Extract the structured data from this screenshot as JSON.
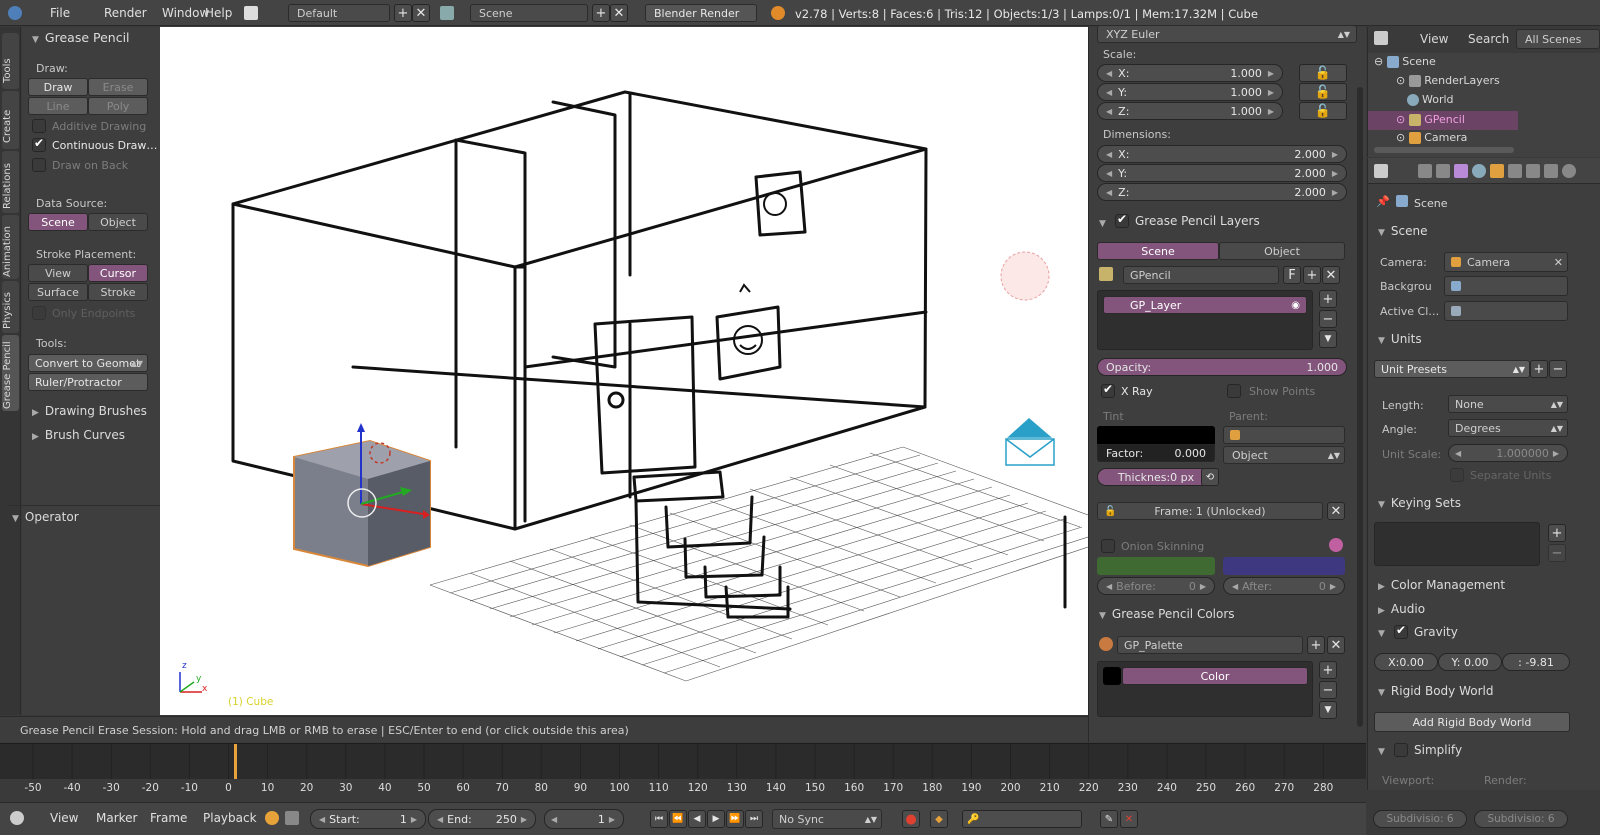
{
  "topbar": {
    "menus": [
      "File",
      "Render",
      "Window",
      "Help"
    ],
    "layout": "Default",
    "scene": "Scene",
    "engine": "Blender Render",
    "stats": "v2.78 | Verts:8 | Faces:6 | Tris:12 | Objects:1/3 | Lamps:0/1 | Mem:17.32M | Cube"
  },
  "left_tabs": [
    "Tools",
    "Create",
    "Relations",
    "Animation",
    "Physics",
    "Grease Pencil"
  ],
  "gp_panel": {
    "title": "Grease Pencil",
    "draw_label": "Draw:",
    "draw": "Draw",
    "erase": "Erase",
    "line": "Line",
    "poly": "Poly",
    "additive": "Additive Drawing",
    "continuous": "Continuous Draw…",
    "draw_on_back": "Draw on Back",
    "data_source": "Data Source:",
    "scene": "Scene",
    "object": "Object",
    "stroke_placement": "Stroke Placement:",
    "view": "View",
    "cursor": "Cursor",
    "surface": "Surface",
    "stroke": "Stroke",
    "only_endpoints": "Only Endpoints",
    "tools": "Tools:",
    "convert": "Convert to Geomet",
    "ruler": "Ruler/Protractor",
    "drawing_brushes": "Drawing Brushes",
    "brush_curves": "Brush Curves",
    "operator": "Operator"
  },
  "viewport": {
    "object_label": "(1) Cube",
    "status": "Grease Pencil Erase Session: Hold and drag LMB or RMB to erase | ESC/Enter to end  (or click outside this area)"
  },
  "props": {
    "rotation_mode": "XYZ Euler",
    "scale_label": "Scale:",
    "scale": [
      [
        "X:",
        "1.000"
      ],
      [
        "Y:",
        "1.000"
      ],
      [
        "Z:",
        "1.000"
      ]
    ],
    "dimensions_label": "Dimensions:",
    "dimensions": [
      [
        "X:",
        "2.000"
      ],
      [
        "Y:",
        "2.000"
      ],
      [
        "Z:",
        "2.000"
      ]
    ],
    "gp_layers_title": "Grease Pencil Layers",
    "scene": "Scene",
    "object": "Object",
    "gpencil": "GPencil",
    "f": "F",
    "layer": "GP_Layer",
    "opacity_label": "Opacity:",
    "opacity": "1.000",
    "xray": "X Ray",
    "show_points": "Show Points",
    "tint": "Tint",
    "parent": "Parent:",
    "factor_label": "Factor:",
    "factor": "0.000",
    "parent_type": "Object",
    "thickness": "Thicknes:0 px",
    "frame": "Frame: 1 (Unlocked)",
    "onion": "Onion Skinning",
    "before": "Before:",
    "before_val": "0",
    "after": "After:",
    "after_val": "0",
    "colors_title": "Grease Pencil Colors",
    "palette": "GP_Palette",
    "color": "Color"
  },
  "outliner": {
    "menus": [
      "View",
      "Search"
    ],
    "scope": "All Scenes",
    "items": [
      "Scene",
      "RenderLayers",
      "World",
      "GPencil",
      "Camera"
    ]
  },
  "scene_props": {
    "breadcrumb": "Scene",
    "scene_title": "Scene",
    "camera_label": "Camera:",
    "camera": "Camera",
    "background_label": "Backgrou",
    "active_clip_label": "Active Cl…",
    "units_title": "Units",
    "unit_presets": "Unit Presets",
    "length_label": "Length:",
    "length": "None",
    "angle_label": "Angle:",
    "angle": "Degrees",
    "unit_scale_label": "Unit Scale:",
    "unit_scale": "1.000000",
    "separate_units": "Separate Units",
    "keying_title": "Keying Sets",
    "color_mgmt": "Color Management",
    "audio": "Audio",
    "gravity": "Gravity",
    "gx": "X:0.00",
    "gy": "Y: 0.00",
    "gz": ":   -9.81",
    "rigid_title": "Rigid Body World",
    "add_rigid": "Add Rigid Body World",
    "simplify": "Simplify",
    "viewport": "Viewport:",
    "render": "Render:",
    "subdiv1": "Subdivisio: 6",
    "subdiv2": "Subdivisio: 6"
  },
  "timeline": {
    "ticks": [
      "-50",
      "-40",
      "-30",
      "-20",
      "-10",
      "0",
      "10",
      "20",
      "30",
      "40",
      "50",
      "60",
      "70",
      "80",
      "90",
      "100",
      "110",
      "120",
      "130",
      "140",
      "150",
      "160",
      "170",
      "180",
      "190",
      "200",
      "210",
      "220",
      "230",
      "240",
      "250",
      "260",
      "270",
      "280"
    ],
    "menus": [
      "View",
      "Marker",
      "Frame",
      "Playback"
    ],
    "start_label": "Start:",
    "start": "1",
    "end_label": "End:",
    "end": "250",
    "current": "1",
    "sync": "No Sync"
  },
  "colors": {
    "accent": "#83557c",
    "bg": "#3a3a3a",
    "viewport": "#ffffff",
    "timeline_cursor": "#e8a23a"
  }
}
